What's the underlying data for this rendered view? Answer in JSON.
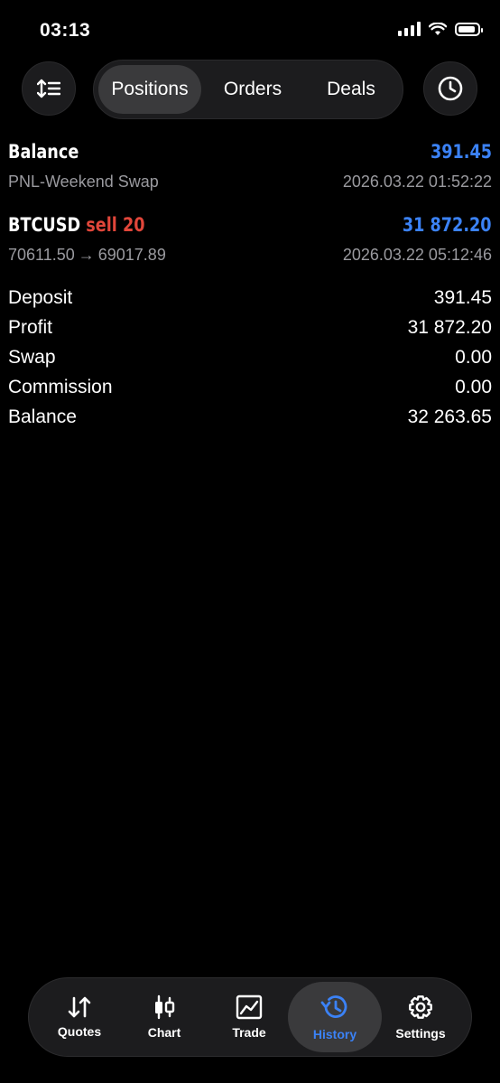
{
  "status_bar": {
    "time": "03:13"
  },
  "segments": {
    "positions": "Positions",
    "orders": "Orders",
    "deals": "Deals",
    "active": "Positions"
  },
  "deals": [
    {
      "title": "Balance",
      "action": "",
      "amount": "391.45",
      "subtitle": "PNL-Weekend Swap",
      "timestamp": "2026.03.22 01:52:22"
    },
    {
      "title": "BTCUSD",
      "action": "sell 20",
      "amount": "31 872.20",
      "price_from": "70611.50",
      "arrow": "→",
      "price_to": "69017.89",
      "timestamp": "2026.03.22 05:12:46"
    }
  ],
  "summary": [
    {
      "label": "Deposit",
      "value": "391.45"
    },
    {
      "label": "Profit",
      "value": "31 872.20"
    },
    {
      "label": "Swap",
      "value": "0.00"
    },
    {
      "label": "Commission",
      "value": "0.00"
    },
    {
      "label": "Balance",
      "value": "32 263.65"
    }
  ],
  "tabbar": {
    "quotes": "Quotes",
    "chart": "Chart",
    "trade": "Trade",
    "history": "History",
    "settings": "Settings",
    "active": "History"
  },
  "colors": {
    "accent": "#3b82f6",
    "sell": "#e1463a",
    "background": "#000000",
    "muted": "#9a9a9f"
  },
  "icons": [
    "sort-icon",
    "clock-icon",
    "quotes-icon",
    "chart-icon",
    "trade-icon",
    "history-icon",
    "settings-icon"
  ]
}
